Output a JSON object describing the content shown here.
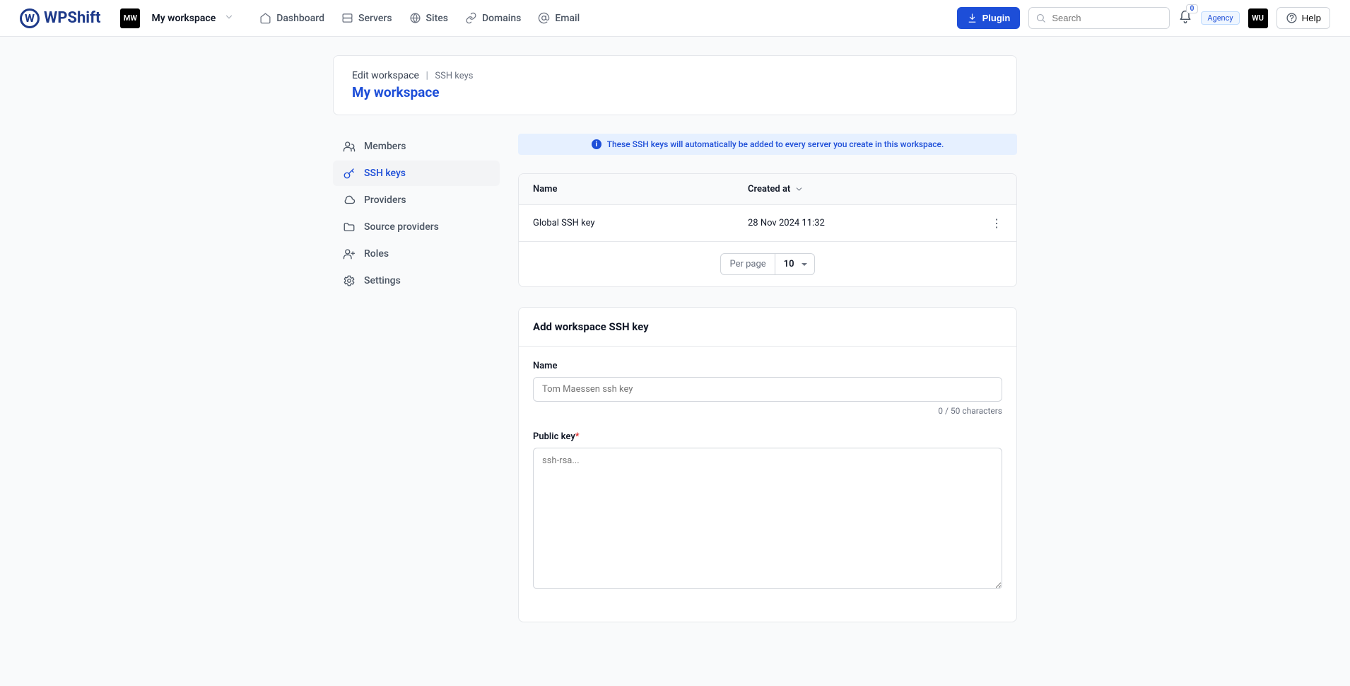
{
  "brand": {
    "name": "WPShift",
    "logo_letter": "W"
  },
  "workspace": {
    "badge": "MW",
    "name": "My workspace"
  },
  "nav": {
    "dashboard": "Dashboard",
    "servers": "Servers",
    "sites": "Sites",
    "domains": "Domains",
    "email": "Email"
  },
  "topbar": {
    "plugin_label": "Plugin",
    "search_placeholder": "Search",
    "notification_count": "0",
    "agency_label": "Agency",
    "user_badge": "WU",
    "help_label": "Help"
  },
  "header": {
    "title": "Edit workspace",
    "subtitle": "SSH keys",
    "workspace_name": "My workspace"
  },
  "sidebar": {
    "members": "Members",
    "ssh_keys": "SSH keys",
    "providers": "Providers",
    "source_providers": "Source providers",
    "roles": "Roles",
    "settings": "Settings"
  },
  "banner": "These SSH keys will automatically be added to every server you create in this workspace.",
  "table": {
    "col_name": "Name",
    "col_created": "Created at",
    "rows": [
      {
        "name": "Global SSH key",
        "created": "28 Nov 2024 11:32"
      }
    ],
    "per_page_label": "Per page",
    "per_page_value": "10"
  },
  "form": {
    "title": "Add workspace SSH key",
    "name_label": "Name",
    "name_placeholder": "Tom Maessen ssh key",
    "char_counter": "0 / 50 characters",
    "publickey_label": "Public key",
    "publickey_placeholder": "ssh-rsa..."
  }
}
